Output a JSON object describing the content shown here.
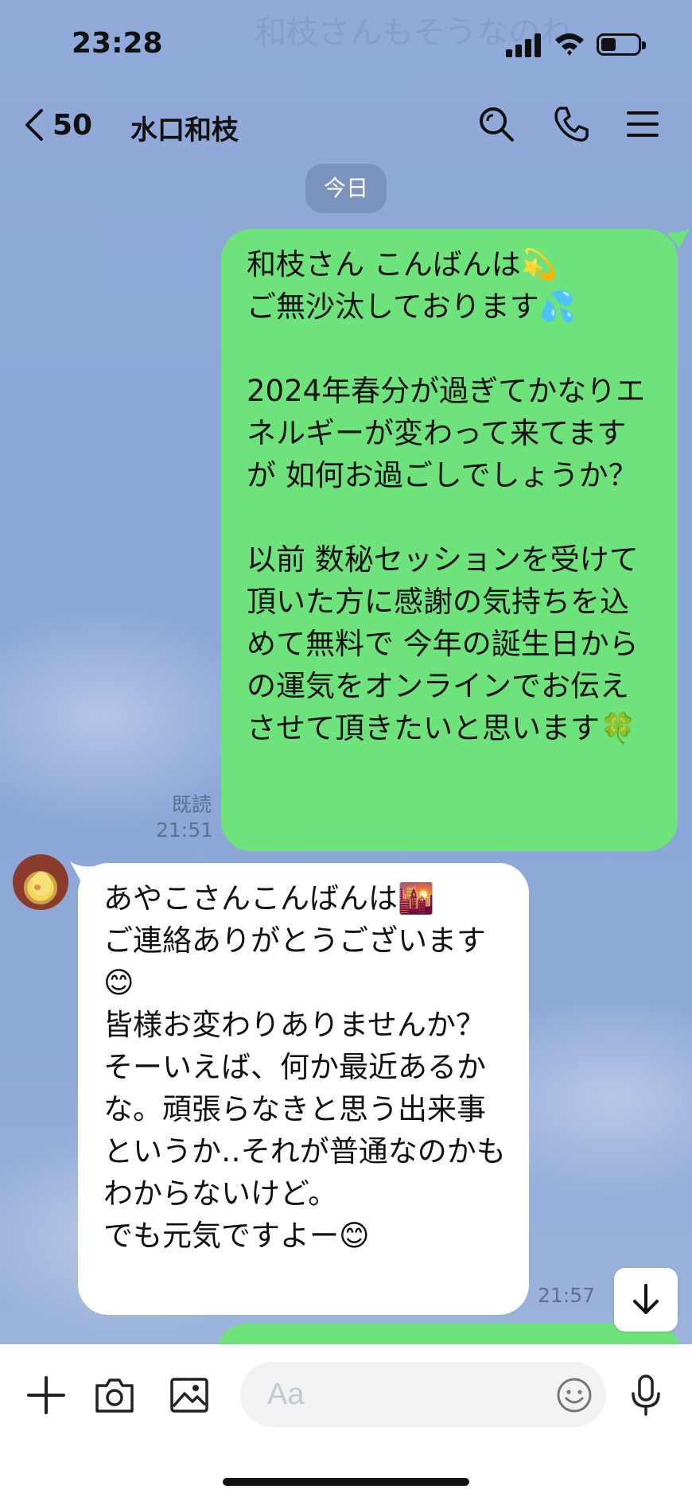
{
  "status_bar": {
    "time": "23:28"
  },
  "background_ghost": "和枝さんもそうなのね",
  "header": {
    "back_count": "50",
    "title": "水口和枝"
  },
  "date_chip": "今日",
  "messages": [
    {
      "direction": "outgoing",
      "text": "和枝さん こんばんは💫\nご無沙汰しております💦\n\n2024年春分が過ぎてかなりエネルギーが変わって来てますが 如何お過ごしでしょうか？\n\n以前 数秘セッションを受けて頂いた方に感謝の気持ちを込めて無料で 今年の誕生日からの運気をオンラインでお伝えさせて頂きたいと思います🍀",
      "read_label": "既読",
      "time": "21:51"
    },
    {
      "direction": "incoming",
      "text": "あやこさんこんばんは🌇\nご連絡ありがとうございます😊\n皆様お変わりありませんか？\nそーいえば、何か最近あるかな。頑張らなきと思う出来事というか‥それが普通なのかもわからないけど。\nでも元気ですよー😊",
      "time": "21:57"
    }
  ],
  "input": {
    "placeholder": "Aa"
  },
  "colors": {
    "outgoing_bubble": "#6fe37b",
    "incoming_bubble": "#ffffff",
    "background": "#8ea7d6"
  }
}
